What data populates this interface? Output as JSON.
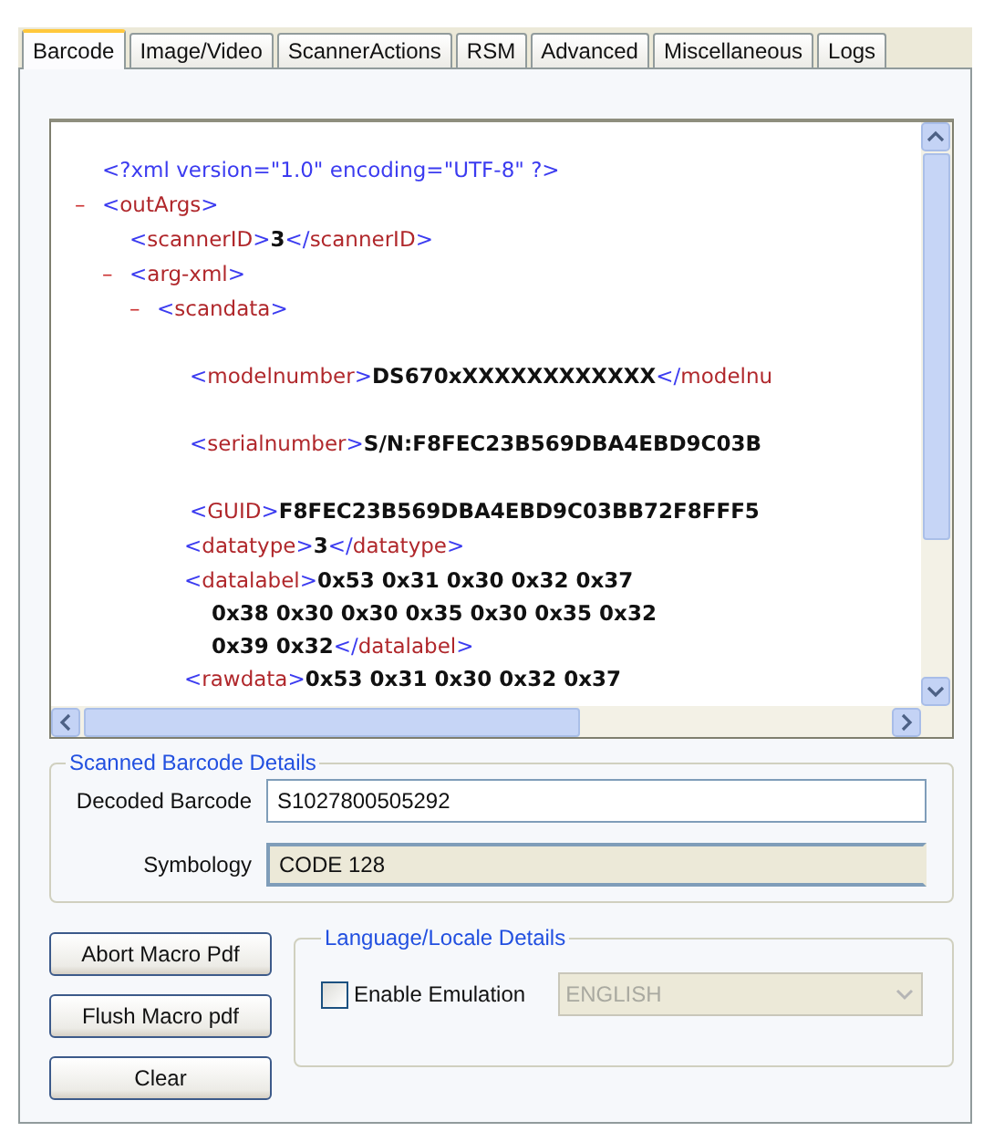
{
  "tabs": [
    {
      "label": "Barcode",
      "selected": true
    },
    {
      "label": "Image/Video",
      "selected": false
    },
    {
      "label": "ScannerActions",
      "selected": false
    },
    {
      "label": "RSM",
      "selected": false
    },
    {
      "label": "Advanced",
      "selected": false
    },
    {
      "label": "Miscellaneous",
      "selected": false
    },
    {
      "label": "Logs",
      "selected": false
    }
  ],
  "xml_view": {
    "nodes": [
      {
        "kind": "tag",
        "segments": [
          {
            "kind": "punct",
            "text": "<?xml version=\"1.0\" encoding=\"UTF-8\" ?>"
          }
        ]
      },
      {
        "kind": "tag",
        "toggle": "–",
        "segments": [
          {
            "kind": "punct",
            "text": "<"
          },
          {
            "kind": "name",
            "text": "outArgs"
          },
          {
            "kind": "punct",
            "text": ">"
          }
        ],
        "children": [
          {
            "kind": "tag",
            "segments": [
              {
                "kind": "punct",
                "text": "<"
              },
              {
                "kind": "name",
                "text": "scannerID"
              },
              {
                "kind": "punct",
                "text": ">"
              },
              {
                "kind": "value",
                "text": "3"
              },
              {
                "kind": "punct",
                "text": "</"
              },
              {
                "kind": "name",
                "text": "scannerID"
              },
              {
                "kind": "punct",
                "text": ">"
              }
            ]
          },
          {
            "kind": "tag",
            "toggle": "–",
            "segments": [
              {
                "kind": "punct",
                "text": "<"
              },
              {
                "kind": "name",
                "text": "arg-xml"
              },
              {
                "kind": "punct",
                "text": ">"
              }
            ],
            "children": [
              {
                "kind": "tag",
                "toggle": "–",
                "segments": [
                  {
                    "kind": "punct",
                    "text": "<"
                  },
                  {
                    "kind": "name",
                    "text": "scandata"
                  },
                  {
                    "kind": "punct",
                    "text": ">"
                  }
                ],
                "children": [
                  {
                    "kind": "padded",
                    "segments": [
                      {
                        "kind": "punct",
                        "text": "<"
                      },
                      {
                        "kind": "name",
                        "text": "modelnumber"
                      },
                      {
                        "kind": "punct",
                        "text": ">"
                      },
                      {
                        "kind": "value",
                        "text": "DS670xXXXXXXXXXXXX"
                      },
                      {
                        "kind": "punct",
                        "text": "</"
                      },
                      {
                        "kind": "name",
                        "text": "modelnu"
                      }
                    ]
                  },
                  {
                    "kind": "padded",
                    "segments": [
                      {
                        "kind": "punct",
                        "text": "<"
                      },
                      {
                        "kind": "name",
                        "text": "serialnumber"
                      },
                      {
                        "kind": "punct",
                        "text": ">"
                      },
                      {
                        "kind": "value",
                        "text": "S/N:F8FEC23B569DBA4EBD9C03B"
                      }
                    ]
                  },
                  {
                    "kind": "padded",
                    "segments": [
                      {
                        "kind": "punct",
                        "text": "<"
                      },
                      {
                        "kind": "name",
                        "text": "GUID"
                      },
                      {
                        "kind": "punct",
                        "text": ">"
                      },
                      {
                        "kind": "value",
                        "text": "F8FEC23B569DBA4EBD9C03BB72F8FFF5"
                      }
                    ]
                  },
                  {
                    "kind": "tag",
                    "segments": [
                      {
                        "kind": "punct",
                        "text": "<"
                      },
                      {
                        "kind": "name",
                        "text": "datatype"
                      },
                      {
                        "kind": "punct",
                        "text": ">"
                      },
                      {
                        "kind": "value",
                        "text": "3"
                      },
                      {
                        "kind": "punct",
                        "text": "</"
                      },
                      {
                        "kind": "name",
                        "text": "datatype"
                      },
                      {
                        "kind": "punct",
                        "text": ">"
                      }
                    ]
                  },
                  {
                    "kind": "wrap",
                    "segments": [
                      {
                        "kind": "punct",
                        "text": "<"
                      },
                      {
                        "kind": "name",
                        "text": "datalabel"
                      },
                      {
                        "kind": "punct",
                        "text": ">"
                      },
                      {
                        "kind": "value",
                        "text": "0x53 0x31 0x30 0x32 0x37 0x38 0x30 0x30 0x35 0x30 0x35 0x32 0x39 0x32"
                      },
                      {
                        "kind": "punct",
                        "text": "</"
                      },
                      {
                        "kind": "name",
                        "text": "datalabel"
                      },
                      {
                        "kind": "punct",
                        "text": ">"
                      }
                    ]
                  },
                  {
                    "kind": "tag",
                    "segments": [
                      {
                        "kind": "punct",
                        "text": "<"
                      },
                      {
                        "kind": "name",
                        "text": "rawdata"
                      },
                      {
                        "kind": "punct",
                        "text": ">"
                      },
                      {
                        "kind": "value",
                        "text": "0x53 0x31 0x30 0x32 0x37"
                      }
                    ]
                  }
                ]
              }
            ]
          }
        ]
      }
    ]
  },
  "scanned_details": {
    "title": "Scanned Barcode Details",
    "fields": [
      {
        "label": "Decoded Barcode",
        "value": "S1027800505292",
        "readonly": false
      },
      {
        "label": "Symbology",
        "value": "CODE 128",
        "readonly": true
      }
    ]
  },
  "buttons": [
    "Abort Macro Pdf",
    "Flush Macro  pdf",
    "Clear"
  ],
  "language_details": {
    "title": "Language/Locale Details",
    "checkbox": {
      "label": "Enable Emulation",
      "checked": false
    },
    "dropdown": {
      "value": "ENGLISH",
      "disabled": true
    }
  }
}
